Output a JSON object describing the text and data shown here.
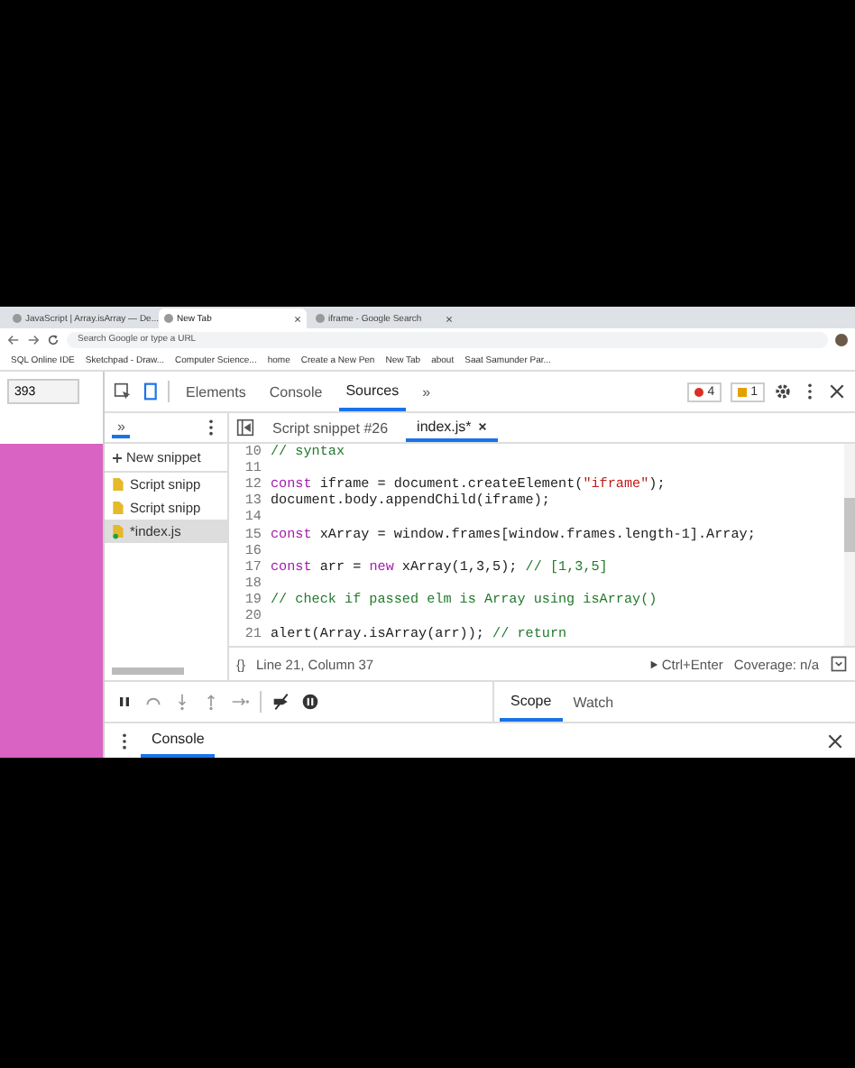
{
  "browser": {
    "tabs": [
      {
        "title": "JavaScript | Array.isArray — De...",
        "selected": false
      },
      {
        "title": "New Tab",
        "selected": true
      },
      {
        "title": "iframe - Google Search",
        "selected": false
      }
    ],
    "address": {
      "placeholder": "Search Google or type a URL"
    },
    "bookmarks": [
      {
        "label": "SQL Online IDE"
      },
      {
        "label": "Sketchpad - Draw..."
      },
      {
        "label": "Computer Science..."
      },
      {
        "label": "home"
      },
      {
        "label": "Create a New Pen"
      },
      {
        "label": "New Tab"
      },
      {
        "label": "about"
      },
      {
        "label": "Saat Samunder Par..."
      }
    ]
  },
  "page": {
    "width_field": "393"
  },
  "devtools": {
    "panels": [
      {
        "label": "Elements",
        "selected": false
      },
      {
        "label": "Console",
        "selected": false
      },
      {
        "label": "Sources",
        "selected": true
      }
    ],
    "more": "»",
    "errors": "4",
    "warnings": "1",
    "navigator": {
      "more": "»",
      "new_snippet": "New snippet",
      "files": [
        {
          "name": "Script snipp",
          "selected": false,
          "modified": false
        },
        {
          "name": "Script snipp",
          "selected": false,
          "modified": false
        },
        {
          "name": "*index.js",
          "selected": true,
          "modified": true
        }
      ]
    },
    "editor_tabs": [
      {
        "label": "Script snippet #26",
        "selected": false
      },
      {
        "label": "index.js*",
        "selected": true
      }
    ],
    "code": [
      {
        "number": "10",
        "tokens": [
          {
            "kind": "comment",
            "text": "// syntax"
          }
        ]
      },
      {
        "number": "11"
      },
      {
        "number": "12",
        "tokens": [
          {
            "kind": "keyword",
            "text": "const"
          },
          {
            "kind": "plain",
            "text": " iframe = document.createElement("
          },
          {
            "kind": "string",
            "text": "\"iframe\""
          },
          {
            "kind": "plain",
            "text": ");"
          }
        ]
      },
      {
        "number": "13",
        "tokens": [
          {
            "kind": "plain",
            "text": "document.body.appendChild(iframe);"
          }
        ]
      },
      {
        "number": "14"
      },
      {
        "number": "15",
        "tokens": [
          {
            "kind": "keyword",
            "text": "const"
          },
          {
            "kind": "plain",
            "text": " xArray = window.frames[window.frames.length-1].Array;"
          }
        ]
      },
      {
        "number": "16"
      },
      {
        "number": "17",
        "tokens": [
          {
            "kind": "keyword",
            "text": "const"
          },
          {
            "kind": "plain",
            "text": " arr = "
          },
          {
            "kind": "keyword",
            "text": "new"
          },
          {
            "kind": "plain",
            "text": " xArray(1,3,5); "
          },
          {
            "kind": "comment",
            "text": "// [1,3,5]"
          }
        ]
      },
      {
        "number": "18"
      },
      {
        "number": "19",
        "tokens": [
          {
            "kind": "comment",
            "text": "// check if passed elm is Array using isArray()"
          }
        ]
      },
      {
        "number": "20"
      },
      {
        "number": "21",
        "tokens": [
          {
            "kind": "plain",
            "text": "alert(Array.isArray(arr)); "
          },
          {
            "kind": "comment",
            "text": "// return"
          }
        ]
      }
    ],
    "status": {
      "format": "{}",
      "position": "Line 21, Column 37",
      "run": "Ctrl+Enter",
      "coverage": "Coverage: n/a"
    },
    "sidebar_tabs": [
      {
        "label": "Scope",
        "selected": true
      },
      {
        "label": "Watch",
        "selected": false
      }
    ],
    "drawer_tabs": [
      {
        "label": "Console",
        "selected": true
      }
    ]
  }
}
